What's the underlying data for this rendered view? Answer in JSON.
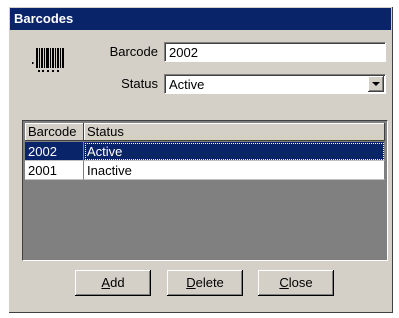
{
  "window": {
    "title": "Barcodes"
  },
  "form": {
    "barcode_label": "Barcode",
    "barcode_value": "2002",
    "status_label": "Status",
    "status_value": "Active"
  },
  "grid": {
    "columns": [
      "Barcode",
      "Status"
    ],
    "rows": [
      {
        "barcode": "2002",
        "status": "Active",
        "selected": true
      },
      {
        "barcode": "2001",
        "status": "Inactive",
        "selected": false
      }
    ]
  },
  "buttons": {
    "add": {
      "mnemonic": "A",
      "rest": "dd"
    },
    "delete": {
      "mnemonic": "D",
      "rest": "elete"
    },
    "close": {
      "mnemonic": "C",
      "rest": "lose"
    }
  }
}
